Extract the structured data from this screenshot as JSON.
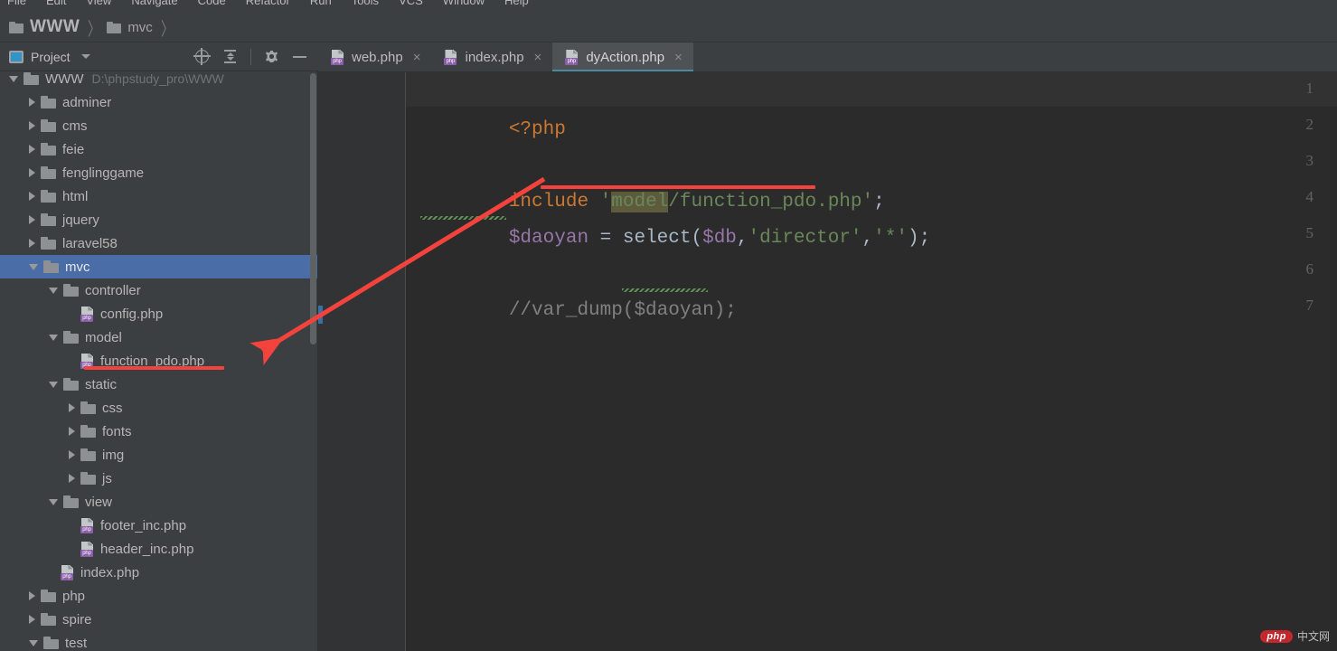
{
  "menubar": {
    "items": [
      "File",
      "Edit",
      "View",
      "Navigate",
      "Code",
      "Refactor",
      "Run",
      "Tools",
      "VCS",
      "Window",
      "Help"
    ]
  },
  "breadcrumb": {
    "root": "WWW",
    "sub": "mvc",
    "separator": "〉"
  },
  "toolwindow": {
    "title": "Project",
    "icons": [
      "select-opened-file-icon",
      "collapse-all-icon",
      "settings-gear-icon",
      "hide-icon"
    ]
  },
  "tabs": [
    {
      "label": "web.php",
      "close": "×",
      "active": false
    },
    {
      "label": "index.php",
      "close": "×",
      "active": false
    },
    {
      "label": "dyAction.php",
      "close": "×",
      "active": true
    }
  ],
  "tree": [
    {
      "label": "WWW",
      "path": "D:\\phpstudy_pro\\WWW",
      "type": "folder",
      "state": "open",
      "indent": 0,
      "selected": false,
      "clipped": true
    },
    {
      "label": "adminer",
      "type": "folder",
      "state": "closed",
      "indent": 1,
      "selected": false
    },
    {
      "label": "cms",
      "type": "folder",
      "state": "closed",
      "indent": 1,
      "selected": false
    },
    {
      "label": "feie",
      "type": "folder",
      "state": "closed",
      "indent": 1,
      "selected": false
    },
    {
      "label": "fenglinggame",
      "type": "folder",
      "state": "closed",
      "indent": 1,
      "selected": false
    },
    {
      "label": "html",
      "type": "folder",
      "state": "closed",
      "indent": 1,
      "selected": false
    },
    {
      "label": "jquery",
      "type": "folder",
      "state": "closed",
      "indent": 1,
      "selected": false
    },
    {
      "label": "laravel58",
      "type": "folder",
      "state": "closed",
      "indent": 1,
      "selected": false
    },
    {
      "label": "mvc",
      "type": "folder",
      "state": "open",
      "indent": 1,
      "selected": true
    },
    {
      "label": "controller",
      "type": "folder",
      "state": "open",
      "indent": 2,
      "selected": false
    },
    {
      "label": "config.php",
      "type": "php",
      "state": "leaf",
      "indent": 3,
      "selected": false
    },
    {
      "label": "model",
      "type": "folder",
      "state": "open",
      "indent": 2,
      "selected": false
    },
    {
      "label": "function_pdo.php",
      "type": "php",
      "state": "leaf",
      "indent": 3,
      "selected": false
    },
    {
      "label": "static",
      "type": "folder",
      "state": "open",
      "indent": 2,
      "selected": false
    },
    {
      "label": "css",
      "type": "folder",
      "state": "closed",
      "indent": 3,
      "selected": false
    },
    {
      "label": "fonts",
      "type": "folder",
      "state": "closed",
      "indent": 3,
      "selected": false
    },
    {
      "label": "img",
      "type": "folder",
      "state": "closed",
      "indent": 3,
      "selected": false
    },
    {
      "label": "js",
      "type": "folder",
      "state": "closed",
      "indent": 3,
      "selected": false
    },
    {
      "label": "view",
      "type": "folder",
      "state": "open",
      "indent": 2,
      "selected": false
    },
    {
      "label": "footer_inc.php",
      "type": "php",
      "state": "leaf",
      "indent": 3,
      "selected": false
    },
    {
      "label": "header_inc.php",
      "type": "php",
      "state": "leaf",
      "indent": 3,
      "selected": false
    },
    {
      "label": "index.php",
      "type": "php",
      "state": "leaf",
      "indent": 2,
      "selected": false
    },
    {
      "label": "php",
      "type": "folder",
      "state": "closed",
      "indent": 1,
      "selected": false
    },
    {
      "label": "spire",
      "type": "folder",
      "state": "closed",
      "indent": 1,
      "selected": false
    },
    {
      "label": "test",
      "type": "folder",
      "state": "open",
      "indent": 1,
      "selected": false
    }
  ],
  "editor": {
    "line_numbers": [
      "1",
      "2",
      "3",
      "4",
      "5",
      "6",
      "7"
    ],
    "lines": {
      "l1_open_tag": "<?php",
      "l3_keyword": "include",
      "l3_quote_open": "'",
      "l3_highlighted": "model",
      "l3_path_rest": "/function_pdo.php",
      "l3_quote_close": "'",
      "l3_semicolon": ";",
      "l4_var": "$daoyan",
      "l4_eq": " = ",
      "l4_func": "select",
      "l4_paren_open": "(",
      "l4_arg_var": "$db",
      "l4_comma1": ",",
      "l4_arg_table": "'director'",
      "l4_comma2": ",",
      "l4_arg_star": "'*'",
      "l4_paren_close": ")",
      "l4_semicolon": ";",
      "l6_comment": "//var_dump($daoyan);"
    }
  },
  "annotations": {
    "include_path_underline": "red-underline-on-include-path",
    "tree_file_underline": "red-underline-on-function-pdo-php",
    "arrow": "red-arrow-from-include-path-to-function-pdo-php"
  },
  "watermark": {
    "badge": "php",
    "text": "中文网"
  },
  "colors": {
    "accent_selection": "#4a6da7",
    "annotation_red": "#f4433c",
    "keyword_orange": "#cc7832",
    "string_green": "#6a8759",
    "variable_purple": "#9876aa",
    "code_default": "#a9b7c6",
    "comment_gray": "#808080",
    "tab_active_underline": "#4a8c9e"
  }
}
